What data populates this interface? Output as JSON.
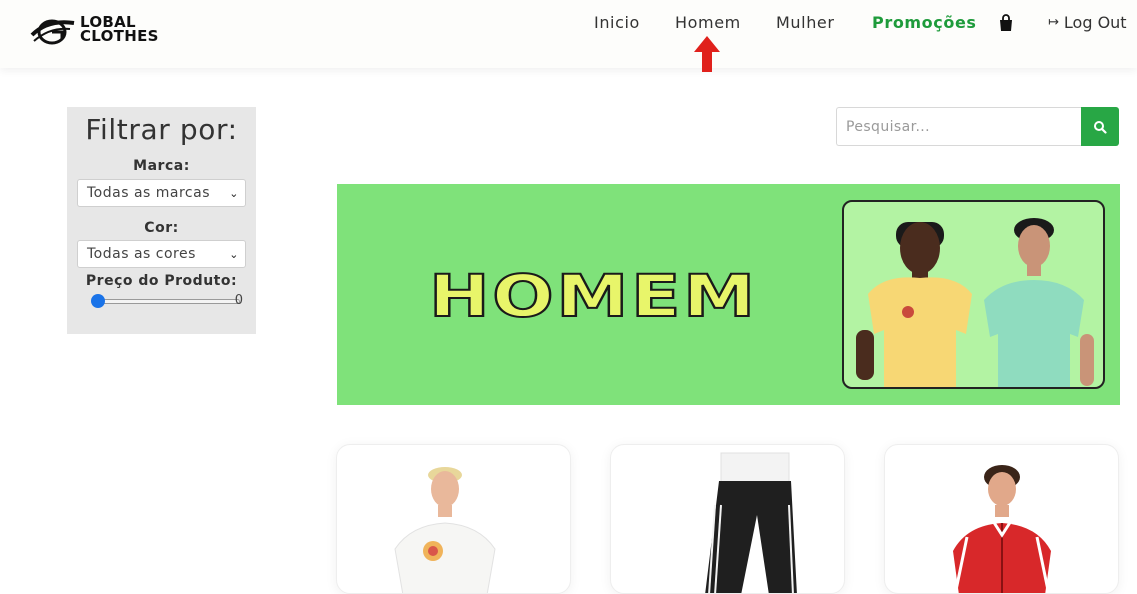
{
  "brand": {
    "logo_line1": "LOBAL",
    "logo_line2": "CLOTHES"
  },
  "nav": {
    "inicio": "Inicio",
    "homem": "Homem",
    "mulher": "Mulher",
    "promocoes": "Promoções",
    "cart_icon": "shopping-bag-icon",
    "logout": "Log Out",
    "logout_icon": "sign-out-icon"
  },
  "filter": {
    "title": "Filtrar por:",
    "marca_label": "Marca:",
    "marca_value": "Todas as marcas",
    "cor_label": "Cor:",
    "cor_value": "Todas as cores",
    "preco_label": "Preço do Produto:",
    "preco_value": "0"
  },
  "search": {
    "placeholder": "Pesquisar...",
    "button_icon": "search-icon"
  },
  "banner": {
    "title": "HOMEM"
  },
  "products": [
    {
      "image": "man-white-tshirt"
    },
    {
      "image": "man-black-track-pants"
    },
    {
      "image": "man-red-track-jacket"
    }
  ],
  "colors": {
    "accent_green": "#28a745",
    "promo_green": "#1e9b3b",
    "banner_green": "#7fe27a",
    "banner_title_yellow": "#e8f56a",
    "annotation_arrow": "#e0211c"
  }
}
